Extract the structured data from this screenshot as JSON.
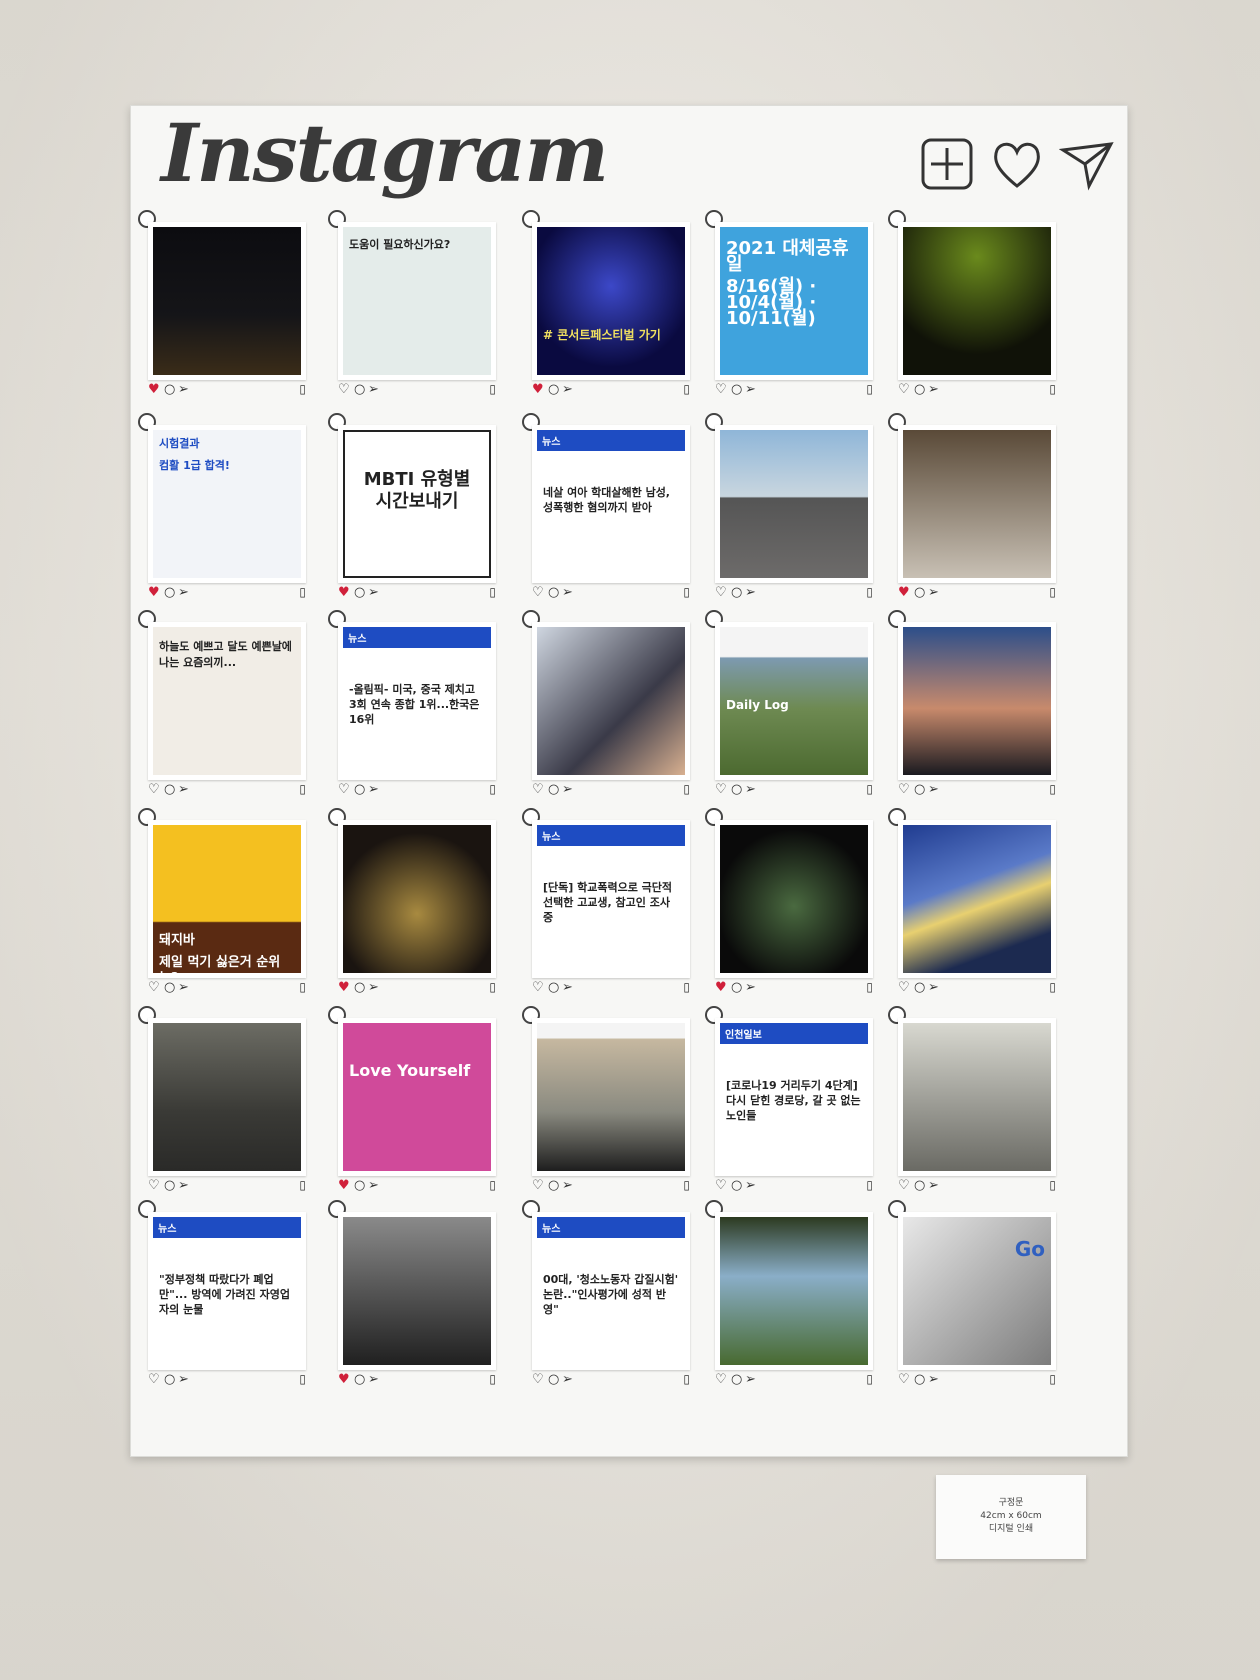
{
  "logo": "Instagram",
  "posts": [
    {
      "cap": "",
      "text": ""
    },
    {
      "cap": "도움이 필요하신가요?",
      "text": ""
    },
    {
      "cap": "# 콘서트페스티벌 가기",
      "text": ""
    },
    {
      "cap": "2021 대체공휴일",
      "text": "8/16(월) · 10/4(월) · 10/11(월)"
    },
    {
      "cap": "",
      "text": ""
    },
    {
      "cap": "시험결과",
      "text": "컴활 1급 합격!"
    },
    {
      "cap": "MBTI 유형별",
      "text": "시간보내기"
    },
    {
      "cap": "뉴스",
      "text": "네살 여아 학대살해한 남성, 성폭행한 혐의까지 받아"
    },
    {
      "cap": "",
      "text": ""
    },
    {
      "cap": "",
      "text": ""
    },
    {
      "cap": "하늘도 예쁘고 달도 예쁜날에 나는 요즘의끼...",
      "text": ""
    },
    {
      "cap": "뉴스",
      "text": "-올림픽- 미국, 중국 제치고 3회 연속 종합 1위...한국은 16위"
    },
    {
      "cap": "",
      "text": ""
    },
    {
      "cap": "Daily Log",
      "text": ""
    },
    {
      "cap": "",
      "text": ""
    },
    {
      "cap": "돼지바",
      "text": "제일 먹기 싫은거 순위는?"
    },
    {
      "cap": "",
      "text": ""
    },
    {
      "cap": "뉴스",
      "text": "[단독] 학교폭력으로 극단적 선택한 고교생, 참고인 조사중"
    },
    {
      "cap": "",
      "text": ""
    },
    {
      "cap": "",
      "text": ""
    },
    {
      "cap": "",
      "text": ""
    },
    {
      "cap": "Love Yourself",
      "text": ""
    },
    {
      "cap": "",
      "text": ""
    },
    {
      "cap": "인천일보",
      "text": "[코로나19 거리두기 4단계] 다시 닫힌 경로당, 갈 곳 없는 노인들"
    },
    {
      "cap": "",
      "text": ""
    },
    {
      "cap": "뉴스",
      "text": "\"정부정책 따랐다가 폐업만\"... 방역에 가려진 자영업자의 눈물"
    },
    {
      "cap": "",
      "text": ""
    },
    {
      "cap": "뉴스",
      "text": "00대, '청소노동자 갑질시험' 논란..\"인사평가에 성적 반영\""
    },
    {
      "cap": "",
      "text": ""
    },
    {
      "cap": "Go",
      "text": ""
    }
  ],
  "plaque": {
    "line1": "구정문",
    "line2": "42cm x 60cm",
    "line3": "디지털 인쇄"
  }
}
